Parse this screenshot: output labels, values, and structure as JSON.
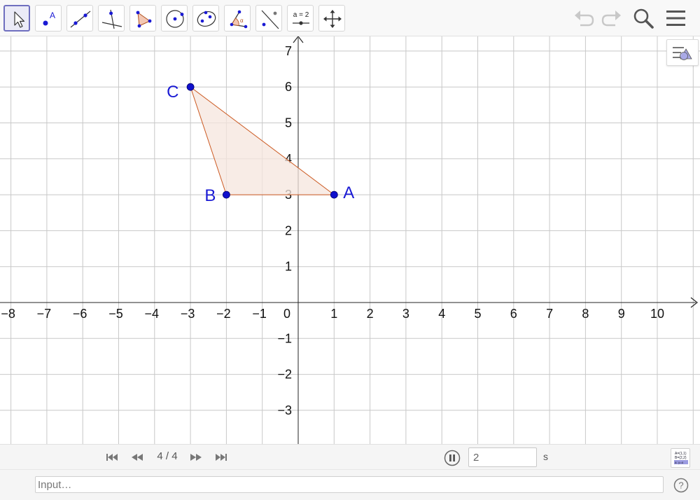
{
  "toolbar": {
    "tools": [
      {
        "id": "move",
        "selected": true
      },
      {
        "id": "point",
        "glyph": "A"
      },
      {
        "id": "line"
      },
      {
        "id": "perpendicular"
      },
      {
        "id": "polygon"
      },
      {
        "id": "circle"
      },
      {
        "id": "conic"
      },
      {
        "id": "angle",
        "glyph": "α"
      },
      {
        "id": "reflect"
      },
      {
        "id": "slider",
        "glyph": "a = 2"
      },
      {
        "id": "move-graphics"
      }
    ],
    "right_icons": [
      "undo-icon",
      "redo-icon",
      "search-icon",
      "menu-icon"
    ]
  },
  "graph": {
    "x_ticks": [
      "−8",
      "−7",
      "−6",
      "−5",
      "−4",
      "−3",
      "−2",
      "−1",
      "1",
      "2",
      "3",
      "4",
      "5",
      "6",
      "7",
      "8",
      "9",
      "10"
    ],
    "y_ticks": [
      "−3",
      "−2",
      "−1",
      "1",
      "2",
      "3",
      "4",
      "5",
      "6",
      "7"
    ],
    "origin_label": "0",
    "points": [
      {
        "label": "A",
        "x": 1,
        "y": 3
      },
      {
        "label": "B",
        "x": -2,
        "y": 3
      },
      {
        "label": "C",
        "x": -3,
        "y": 6
      }
    ],
    "polygon": [
      "A",
      "B",
      "C"
    ],
    "colors": {
      "point": "#1010cc",
      "label": "#1a1ad4",
      "polygon_edge": "#cc5a22",
      "polygon_fill": "#f6e6dd",
      "grid": "#c8c8c8",
      "axis": "#262626"
    }
  },
  "animation": {
    "step_counter": "4 / 4",
    "speed_value": "2",
    "speed_unit": "s"
  },
  "input_bar": {
    "placeholder": "Input…"
  }
}
